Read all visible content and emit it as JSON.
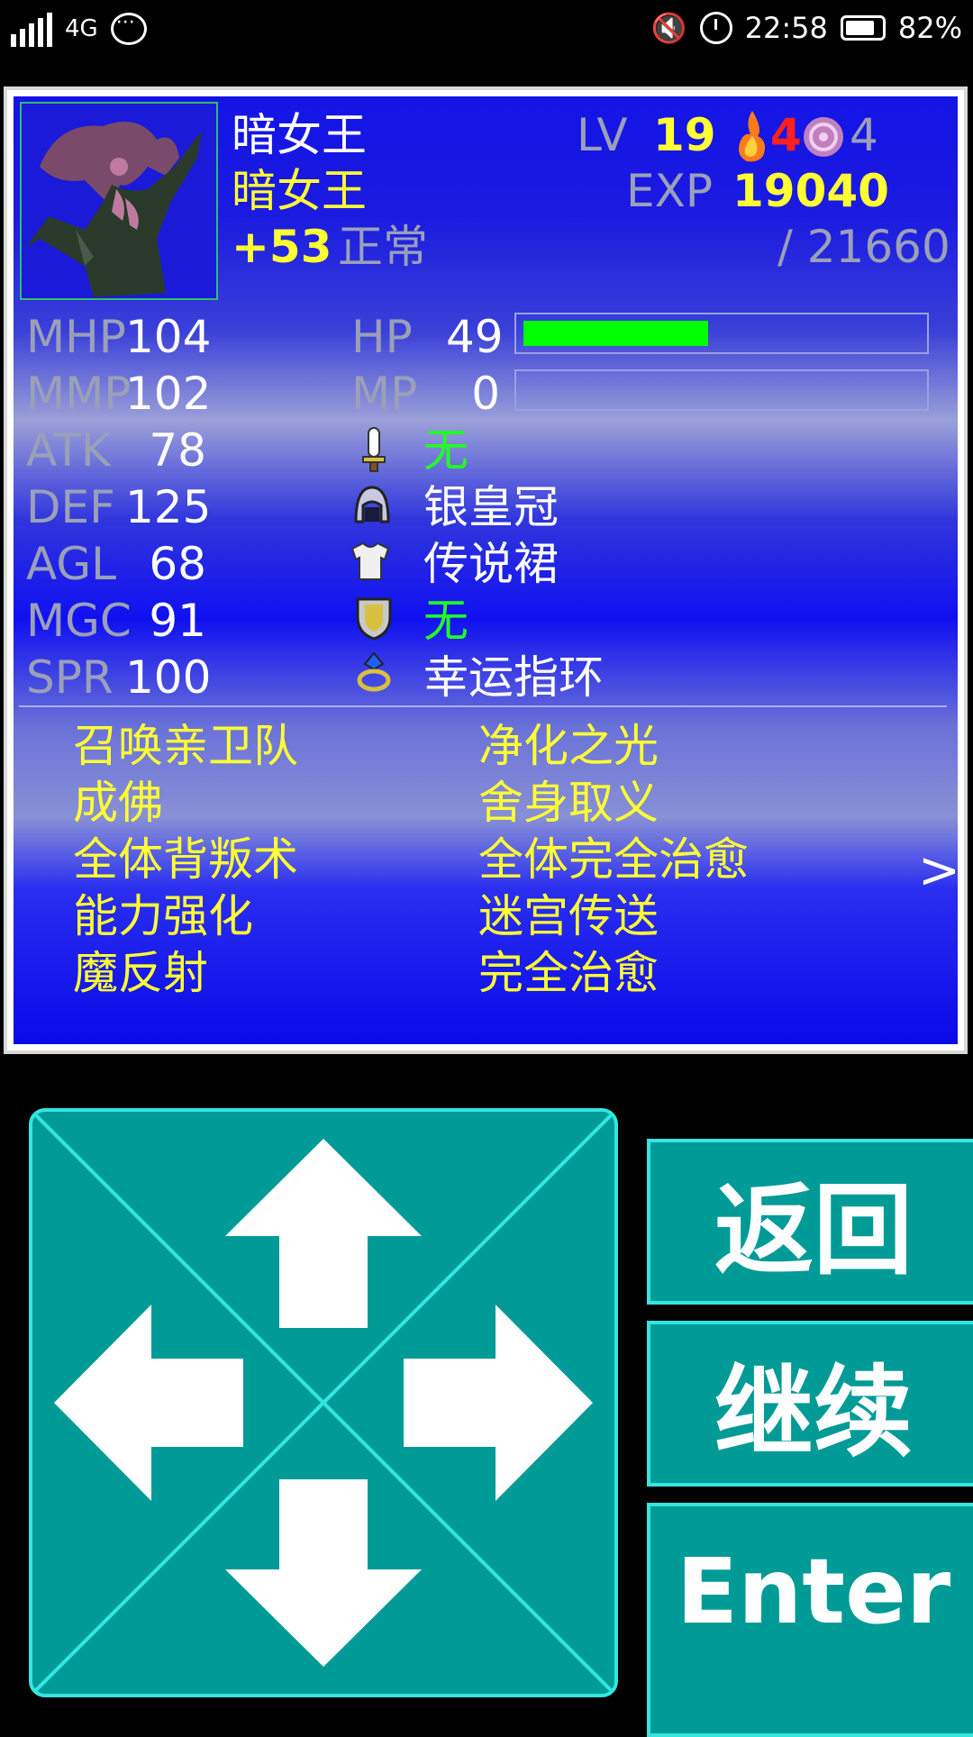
{
  "status_bar": {
    "network": "4G",
    "time": "22:58",
    "battery": "82%",
    "battery_level": 0.82
  },
  "character": {
    "name": "暗女王",
    "class": "暗女王",
    "bonus": "+53",
    "condition": "正常",
    "level_label": "LV",
    "level": "19",
    "fire_count": "4",
    "orb_count": "4",
    "exp_label": "EXP",
    "exp": "19040",
    "exp_next": "/ 21660"
  },
  "stats": [
    {
      "label": "MHP",
      "value": "104"
    },
    {
      "label": "MMP",
      "value": "102"
    },
    {
      "label": "ATK",
      "value": "78"
    },
    {
      "label": "DEF",
      "value": "125"
    },
    {
      "label": "AGL",
      "value": "68"
    },
    {
      "label": "MGC",
      "value": "91"
    },
    {
      "label": "SPR",
      "value": "100"
    }
  ],
  "hp": {
    "label": "HP",
    "value": "49",
    "fraction": 0.47
  },
  "mp": {
    "label": "MP",
    "value": "0",
    "fraction": 0
  },
  "equipment": [
    {
      "icon": "sword-icon",
      "name": "无",
      "empty": true
    },
    {
      "icon": "helmet-icon",
      "name": "银皇冠",
      "empty": false
    },
    {
      "icon": "armor-icon",
      "name": "传说裙",
      "empty": false
    },
    {
      "icon": "shield-icon",
      "name": "无",
      "empty": true
    },
    {
      "icon": "ring-icon",
      "name": "幸运指环",
      "empty": false
    }
  ],
  "skills_left": [
    "召唤亲卫队",
    "成佛",
    "全体背叛术",
    "能力强化",
    "魔反射"
  ],
  "skills_right": [
    "净化之光",
    "舍身取义",
    "全体完全治愈",
    "迷宫传送",
    "完全治愈"
  ],
  "next_page_symbol": ">",
  "controls": {
    "back": "返回",
    "continue": "继续",
    "enter": "Enter"
  },
  "colors": {
    "panel_blue": "#1414e6",
    "label_yellow": "#ffff33",
    "hp_green": "#00ff00",
    "button_teal": "#009b96",
    "button_border": "#33e6e0"
  }
}
